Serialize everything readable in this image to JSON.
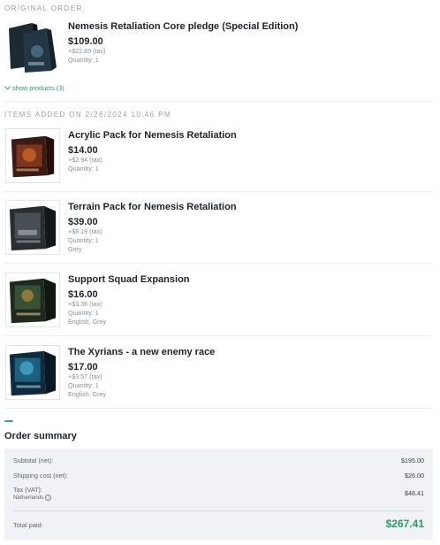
{
  "original_order": {
    "label": "ORIGINAL ORDER",
    "item": {
      "name": "Nemesis Retaliation Core pledge (Special Edition)",
      "price": "$109.00",
      "tax": "+$22.89 (tax)",
      "quantity": "Quantity: 1",
      "icon": "core-box-image"
    },
    "show_products": "show products (3)"
  },
  "added_items": {
    "label": "ITEMS ADDED ON 2/26/2024 10:46 PM",
    "items": [
      {
        "name": "Acrylic Pack for Nemesis Retaliation",
        "price": "$14.00",
        "tax": "+$2.94 (tax)",
        "quantity": "Quantity: 1",
        "variant": ""
      },
      {
        "name": "Terrain Pack for Nemesis Retaliation",
        "price": "$39.00",
        "tax": "+$8.19 (tax)",
        "quantity": "Quantity: 1",
        "variant": "Grey"
      },
      {
        "name": "Support Squad Expansion",
        "price": "$16.00",
        "tax": "+$3.36 (tax)",
        "quantity": "Quantity: 1",
        "variant": "English, Grey"
      },
      {
        "name": "The Xyrians - a new enemy race",
        "price": "$17.00",
        "tax": "+$3.57 (tax)",
        "quantity": "Quantity: 1",
        "variant": "English, Grey"
      }
    ]
  },
  "summary": {
    "title": "Order summary",
    "subtotal_label": "Subtotal (net):",
    "subtotal_value": "$195.00",
    "shipping_label": "Shipping cost (net):",
    "shipping_value": "$26.00",
    "tax_label": "Tax (VAT):",
    "tax_country": "Netherlands",
    "tax_value": "$46.41",
    "total_label": "Total paid:",
    "total_value": "$267.41"
  },
  "colors": {
    "accent": "#2b9a6b",
    "summary_bg": "#f0f2f5"
  }
}
